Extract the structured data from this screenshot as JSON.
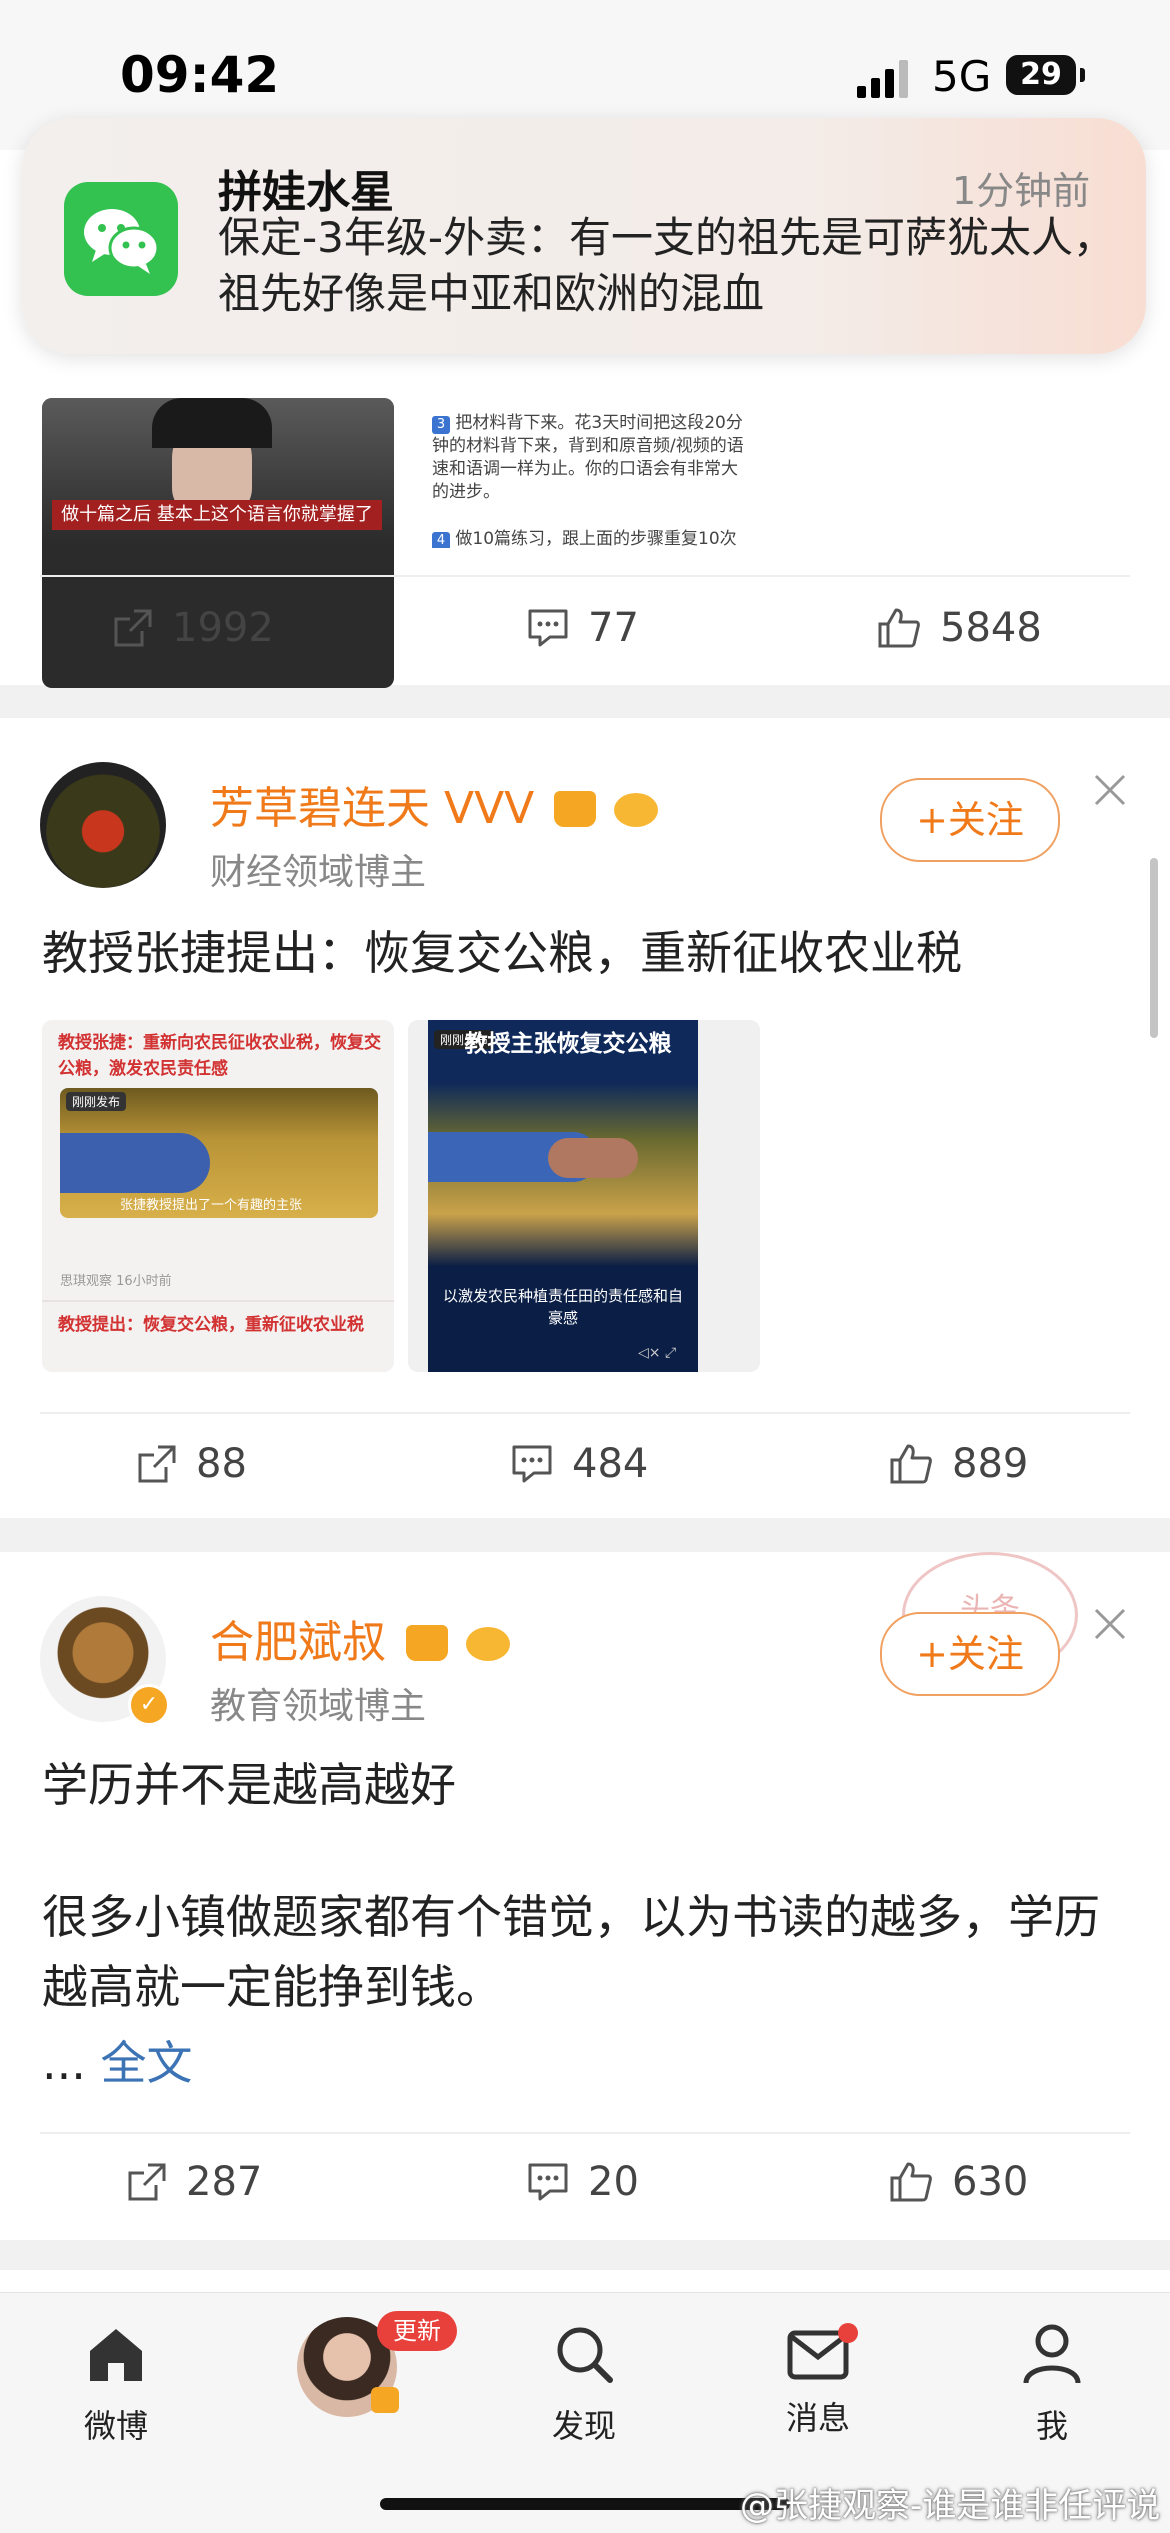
{
  "status_bar": {
    "time": "09:42",
    "network": "5G",
    "battery": "29"
  },
  "notification": {
    "app_icon": "wechat-icon",
    "sender": "拼娃水星",
    "time": "1分钟前",
    "message": "保定-3年级-外卖：有一支的祖先是可萨犹太人，祖先好像是中亚和欧洲的混血"
  },
  "post1": {
    "video_caption": "做十篇之后 基本上这个语言你就掌握了",
    "doc_text_1": "把材料背下来。花3天时间把这段20分钟的材料背下来，背到和原音频/视频的语速和语调一样为止。你的口语会有非常大的进步。",
    "doc_text_2": "做10篇练习，跟上面的步骤重复10次",
    "shares": "1992",
    "comments": "77",
    "likes": "5848"
  },
  "post2": {
    "username": "芳草碧连天 VVV",
    "subtitle": "财经领域博主",
    "follow_label": "+关注",
    "text": "教授张捷提出：恢复交公粮，重新征收农业税",
    "img1_headline": "教授张捷：重新向农民征收农业税，恢复交公粮，激发农民责任感",
    "img1_badge": "刚刚发布",
    "img1_caption": "张捷教授提出了一个有趣的主张",
    "img1_meta": "思琪观察 16小时前",
    "img1_footer": "教授提出：恢复交公粮，重新征收农业税",
    "img2_title": "教授主张恢复交公粮",
    "img2_badge": "刚刚发布",
    "img2_caption": "以激发农民种植责任田的责任感和自豪感",
    "shares": "88",
    "comments": "484",
    "likes": "889"
  },
  "post3": {
    "username": "合肥斌叔",
    "subtitle": "教育领域博主",
    "follow_label": "+关注",
    "stamp_text": "头条",
    "line1": "学历并不是越高越好",
    "line2": "很多小镇做题家都有个错觉，以为书读的越多，学历越高就一定能挣到钱。",
    "more_prefix": "...",
    "more_link": "全文",
    "shares": "287",
    "comments": "20",
    "likes": "630"
  },
  "tabbar": {
    "tabs": [
      {
        "label": "微博",
        "icon": "home-icon"
      },
      {
        "label": "更新",
        "icon": "avatar-story"
      },
      {
        "label": "发现",
        "icon": "search-icon"
      },
      {
        "label": "消息",
        "icon": "mail-icon"
      },
      {
        "label": "我",
        "icon": "profile-icon"
      }
    ]
  },
  "watermark": "@张捷观察-谁是谁非任评说",
  "colors": {
    "accent": "#f07a1a",
    "link": "#3b73b5",
    "wechat": "#33c150",
    "badge": "#e8403a"
  }
}
